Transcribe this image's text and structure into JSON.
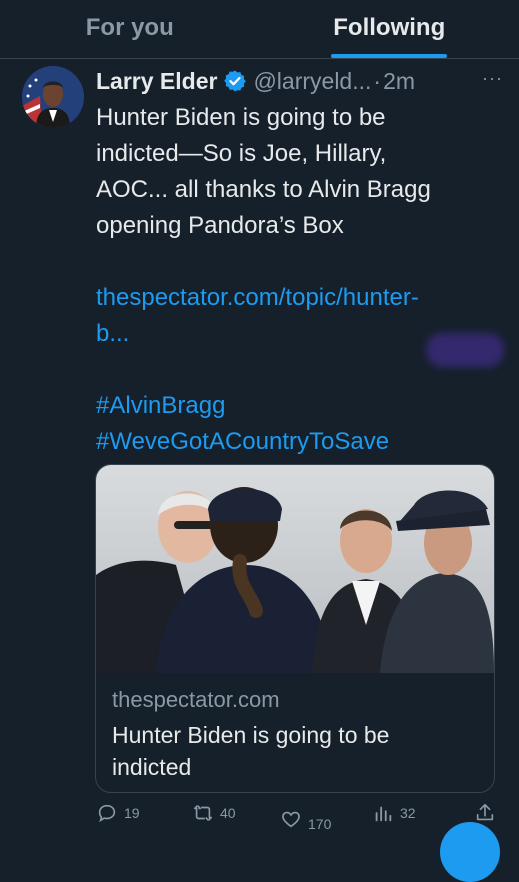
{
  "tabs": {
    "for_you": "For you",
    "following": "Following"
  },
  "tweet": {
    "name": "Larry Elder",
    "handle": "@larryeld...",
    "separator": "·",
    "time": "2m",
    "more": "···",
    "text_lines": [
      "Hunter Biden is going to be",
      "indicted—So is Joe, Hillary,",
      "AOC... all thanks to Alvin Bragg",
      "opening Pandora’s Box"
    ],
    "link_lines": [
      "thespectator.com/topic/hunter-",
      "b..."
    ],
    "hashtags": [
      "#AlvinBragg",
      "#WeveGotACountryToSave"
    ]
  },
  "card": {
    "domain": "thespectator.com",
    "title_lines": [
      "Hunter Biden is going to be",
      "indicted"
    ]
  },
  "actions": {
    "replies": "19",
    "retweets": "40",
    "likes": "170",
    "views": "32"
  },
  "colors": {
    "accent": "#1d9bf0",
    "background": "#15202b",
    "muted": "#8b98a5"
  },
  "icons": [
    "verified-badge-icon",
    "reply-icon",
    "retweet-icon",
    "like-icon",
    "views-icon",
    "share-icon"
  ]
}
